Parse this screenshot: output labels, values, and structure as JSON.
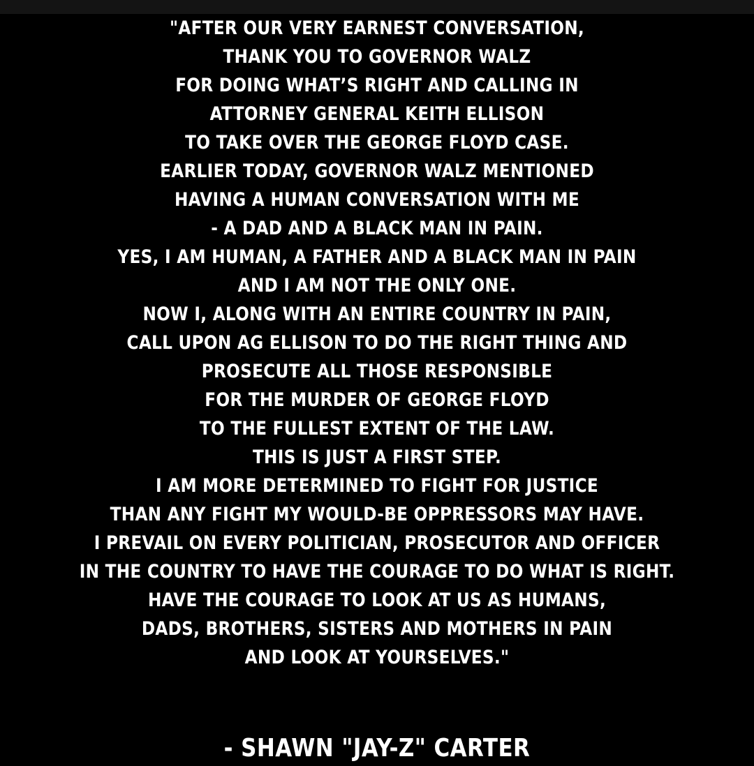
{
  "colors": {
    "background": "#000000",
    "top_strip": "#141414",
    "text": "#ffffff"
  },
  "statement": {
    "lines": [
      "\"AFTER OUR VERY EARNEST CONVERSATION,",
      "THANK YOU TO GOVERNOR WALZ",
      "FOR DOING WHAT’S RIGHT AND CALLING IN",
      "ATTORNEY GENERAL KEITH ELLISON",
      "TO TAKE OVER THE GEORGE FLOYD CASE.",
      "EARLIER TODAY, GOVERNOR WALZ MENTIONED",
      "HAVING A HUMAN CONVERSATION WITH ME",
      "- A DAD AND A BLACK MAN IN PAIN.",
      "YES, I AM HUMAN, A FATHER AND A BLACK MAN IN PAIN",
      "AND I AM NOT THE ONLY ONE.",
      "NOW I, ALONG WITH AN ENTIRE COUNTRY IN PAIN,",
      "CALL UPON AG ELLISON TO DO THE RIGHT THING AND",
      "PROSECUTE ALL THOSE RESPONSIBLE",
      "FOR THE MURDER OF GEORGE FLOYD",
      "TO THE FULLEST EXTENT OF THE LAW.",
      "THIS IS JUST A FIRST STEP.",
      "I AM MORE DETERMINED TO FIGHT FOR JUSTICE",
      "THAN ANY FIGHT MY WOULD-BE OPPRESSORS MAY HAVE.",
      "I PREVAIL ON EVERY POLITICIAN, PROSECUTOR AND OFFICER",
      "IN THE COUNTRY TO HAVE THE COURAGE TO DO WHAT IS RIGHT.",
      "HAVE THE COURAGE TO LOOK AT US AS HUMANS,",
      "DADS, BROTHERS, SISTERS AND MOTHERS IN PAIN",
      "AND LOOK AT YOURSELVES.\""
    ]
  },
  "attribution": "- SHAWN \"JAY-Z\" CARTER"
}
